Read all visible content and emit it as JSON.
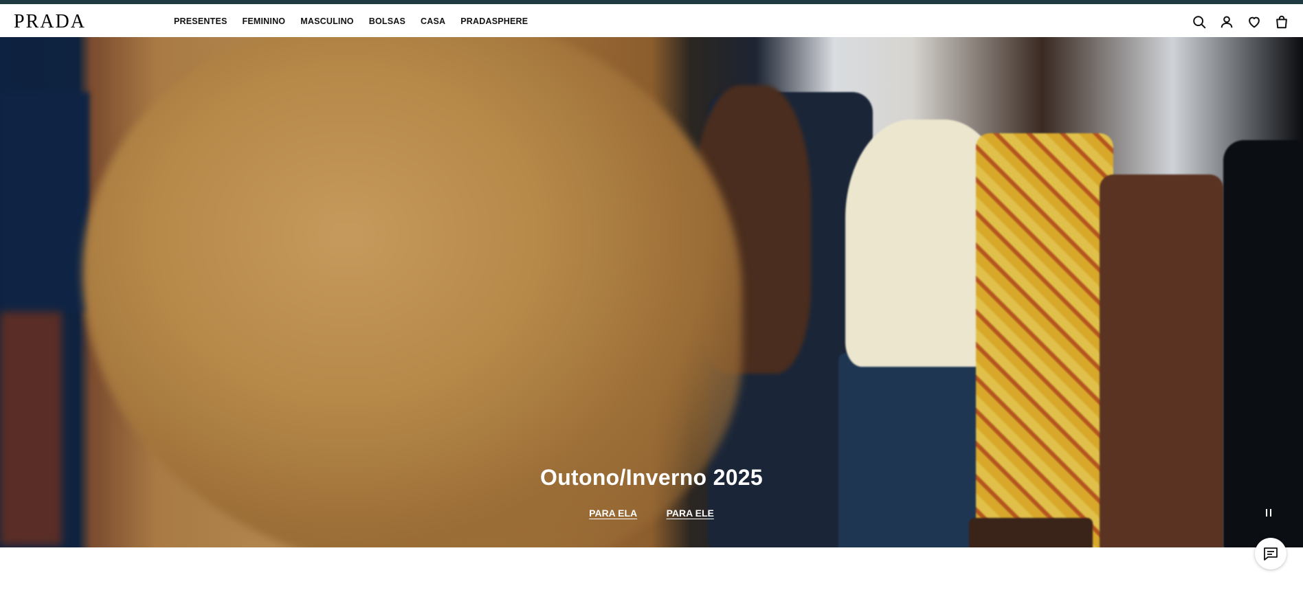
{
  "brand": {
    "logo_text": "PRADA"
  },
  "nav": {
    "items": [
      {
        "label": "PRESENTES"
      },
      {
        "label": "FEMININO"
      },
      {
        "label": "MASCULINO"
      },
      {
        "label": "BOLSAS"
      },
      {
        "label": "CASA"
      },
      {
        "label": "PRADASPHERE"
      }
    ]
  },
  "header_icons": [
    "search-icon",
    "account-icon",
    "wishlist-heart-icon",
    "shopping-bag-icon"
  ],
  "hero": {
    "title": "Outono/Inverno 2025",
    "links": [
      {
        "label": "PARA ELA"
      },
      {
        "label": "PARA ELE"
      }
    ],
    "pause_icon": "pause-icon"
  },
  "chat": {
    "icon": "chat-icon"
  },
  "colors": {
    "top_strip": "#1f3a40",
    "header_bg": "#ffffff",
    "text": "#111111",
    "hero_text": "#ffffff"
  },
  "below": {
    "text": ""
  }
}
